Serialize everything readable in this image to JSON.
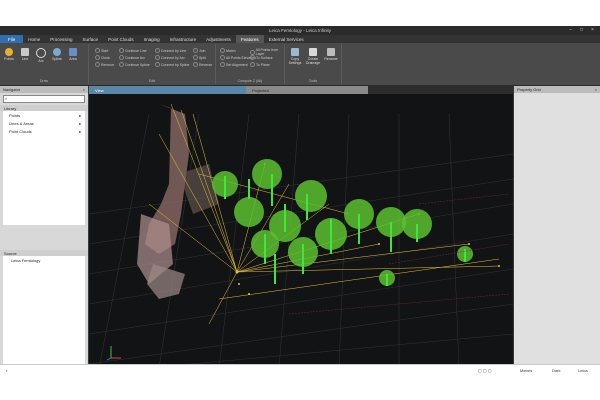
{
  "window": {
    "title": "Leica Femtology - Leica Infinity"
  },
  "menu": {
    "file": "File",
    "items": [
      "Home",
      "Processing",
      "Surface",
      "Point Clouds",
      "Imaging",
      "Infrastructure",
      "Adjustments",
      "Features",
      "External Services"
    ],
    "active_index": 7
  },
  "ribbon": {
    "draw_group_label": "Draw",
    "big_tools": [
      "Points",
      "Line",
      "Arc",
      "Spline",
      "Area"
    ],
    "edit_tools": [
      [
        "Start",
        "Continue Line",
        "Connect by Line"
      ],
      [
        "Close",
        "Continue Arc",
        "Connect by Arc"
      ],
      [
        "Remove",
        "Continue Spline",
        "Connect by Spline"
      ]
    ],
    "edit_group_label": "Edit",
    "split_tools": [
      "Join",
      "Split",
      "Reverse"
    ],
    "adjust_tools": [
      "Match",
      "All Points Elevation",
      "Set Alignment",
      "All Points from Layer",
      "To Surface",
      "To Plane"
    ],
    "adjust_group_label": "Compute Z (Alt)",
    "right_tools": [
      "Copy Settings",
      "Create Drainage",
      "Rename"
    ],
    "tools_group_label": "Tools"
  },
  "navigator": {
    "title": "Navigator",
    "search_placeholder": "",
    "library_label": "Library",
    "library_items": [
      "Points",
      "Lines & Areas",
      "Point Clouds"
    ],
    "source_label": "Source",
    "source_items": [
      "Leica Femtology"
    ],
    "bottom_tab": "Archive"
  },
  "view": {
    "tabs": [
      "View",
      "Projected"
    ],
    "active_tab": 0
  },
  "property_grid": {
    "title": "Property Grid"
  },
  "app_status": {
    "right_items": [
      "Metres",
      "Dark",
      "Leica"
    ]
  },
  "colors": {
    "accent": "#2f6fb0",
    "tree_green": "#5cc12f",
    "line_yellow": "#e9c234",
    "grid": "#3a3f44"
  }
}
